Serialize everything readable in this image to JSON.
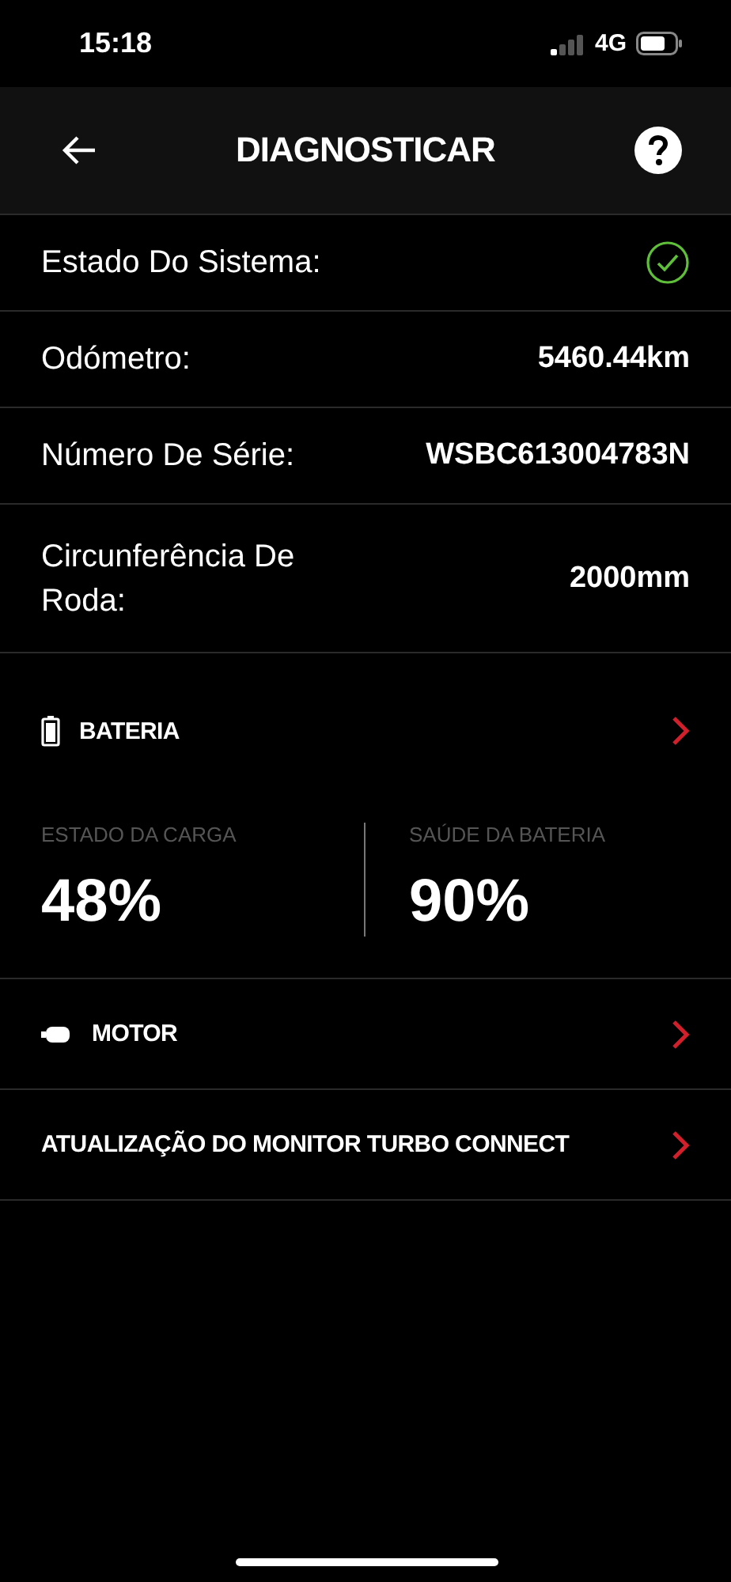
{
  "status_bar": {
    "time": "15:18",
    "network": "4G"
  },
  "header": {
    "title": "DIAGNOSTICAR"
  },
  "info_rows": [
    {
      "kind": "status",
      "label": "Estado Do Sistema:",
      "ok": true
    },
    {
      "kind": "value",
      "label": "Odómetro:",
      "value": "5460.44km"
    },
    {
      "kind": "value",
      "label": "Número De Série:",
      "value": "WSBC613004783N"
    },
    {
      "kind": "value",
      "label": "Circunferência De Roda:",
      "value": "2000mm"
    }
  ],
  "battery": {
    "title": "BATERIA",
    "stats": [
      {
        "label": "ESTADO DA CARGA",
        "value": "48%"
      },
      {
        "label": "SAÚDE DA BATERIA",
        "value": "90%"
      }
    ]
  },
  "links": [
    {
      "kind": "motor",
      "title": "MOTOR"
    },
    {
      "kind": "plain",
      "title": "ATUALIZAÇÃO DO MONITOR TURBO CONNECT"
    }
  ]
}
